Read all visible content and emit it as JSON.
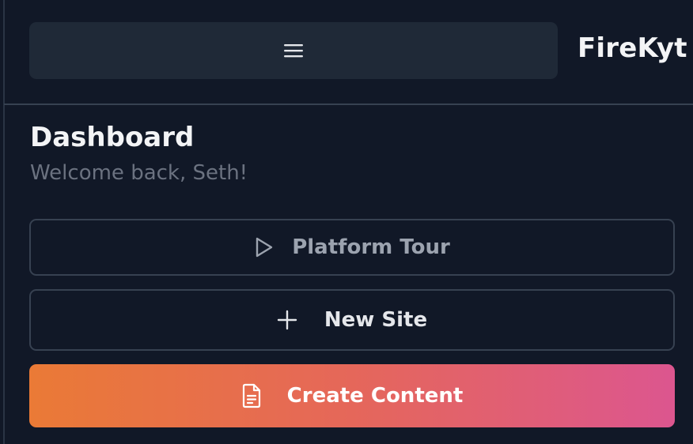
{
  "header": {
    "brand": "FireKyt",
    "menu_icon": "hamburger-menu-icon"
  },
  "page": {
    "title": "Dashboard",
    "subtitle": "Welcome back, Seth!"
  },
  "actions": {
    "platform_tour": {
      "label": "Platform Tour",
      "icon": "play-icon"
    },
    "new_site": {
      "label": "New Site",
      "icon": "plus-icon"
    },
    "create_content": {
      "label": "Create Content",
      "icon": "document-icon"
    }
  },
  "colors": {
    "background": "#111827",
    "surface": "#1f2937",
    "border": "#374151",
    "gradient_start": "#ea7a36",
    "gradient_end": "#dc568f"
  }
}
